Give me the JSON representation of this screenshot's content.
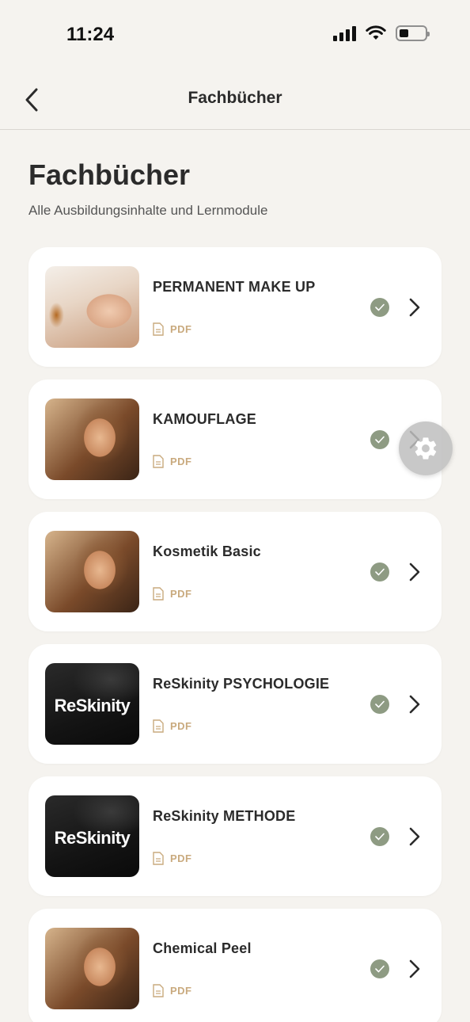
{
  "status_bar": {
    "time": "11:24"
  },
  "nav": {
    "title": "Fachbücher"
  },
  "header": {
    "title": "Fachbücher",
    "subtitle": "Alle Ausbildungsinhalte und Lernmodule"
  },
  "books": [
    {
      "title": "PERMANENT MAKE UP",
      "format": "PDF",
      "completed": true
    },
    {
      "title": "KAMOUFLAGE",
      "format": "PDF",
      "completed": true
    },
    {
      "title": "Kosmetik Basic",
      "format": "PDF",
      "completed": true
    },
    {
      "title": "ReSkinity PSYCHOLOGIE",
      "format": "PDF",
      "completed": true,
      "thumb_text": "ReSkinity"
    },
    {
      "title": "ReSkinity METHODE",
      "format": "PDF",
      "completed": true,
      "thumb_text": "ReSkinity"
    },
    {
      "title": "Chemical Peel",
      "format": "PDF",
      "completed": true
    }
  ],
  "colors": {
    "background": "#f5f3ef",
    "card": "#ffffff",
    "check": "#8e9b83",
    "pdf_accent": "#c9aa7e"
  },
  "icons": {
    "back": "chevron-left-icon",
    "row": "chevron-right-icon",
    "status": "check-circle-icon",
    "file": "document-icon",
    "fab": "gear-icon"
  }
}
